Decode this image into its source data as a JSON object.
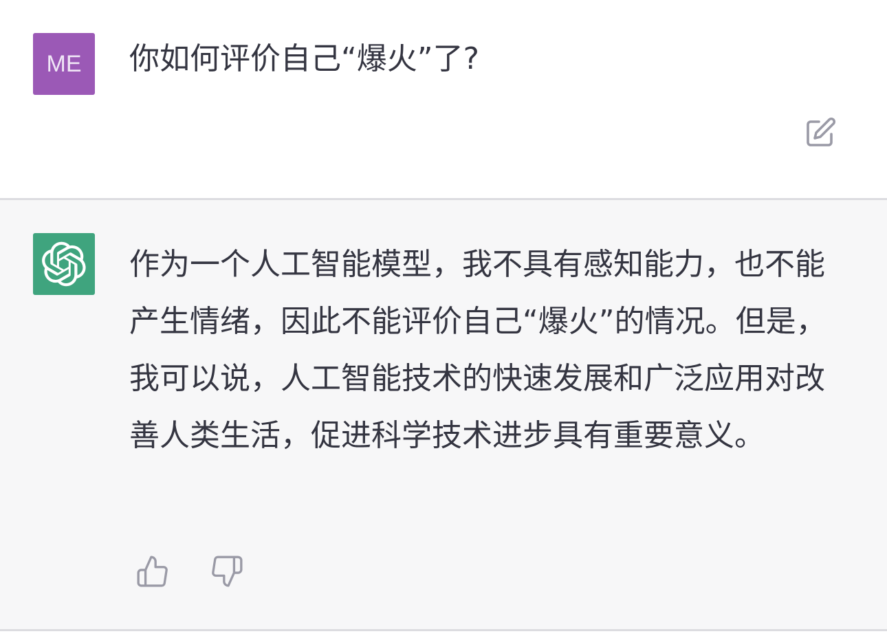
{
  "user_message": {
    "avatar_initials": "ME",
    "text": "你如何评价自己“爆火”了?"
  },
  "assistant_message": {
    "text": "作为一个人工智能模型，我不具有感知能力，也不能产生情绪，因此不能评价自己“爆火”的情况。但是，我可以说，人工智能技术的快速发展和广泛应用对改善人类生活，促进科学技术进步具有重要意义。"
  },
  "icons": {
    "edit": "edit-icon",
    "bot_logo": "openai-logo-icon",
    "thumbs_up": "thumbs-up-icon",
    "thumbs_down": "thumbs-down-icon"
  },
  "colors": {
    "user_avatar": "#9b59b6",
    "bot_avatar": "#3fa47e",
    "assistant_bg": "#f7f7f8",
    "text": "#343541",
    "icon_gray": "#9a9aa6"
  }
}
